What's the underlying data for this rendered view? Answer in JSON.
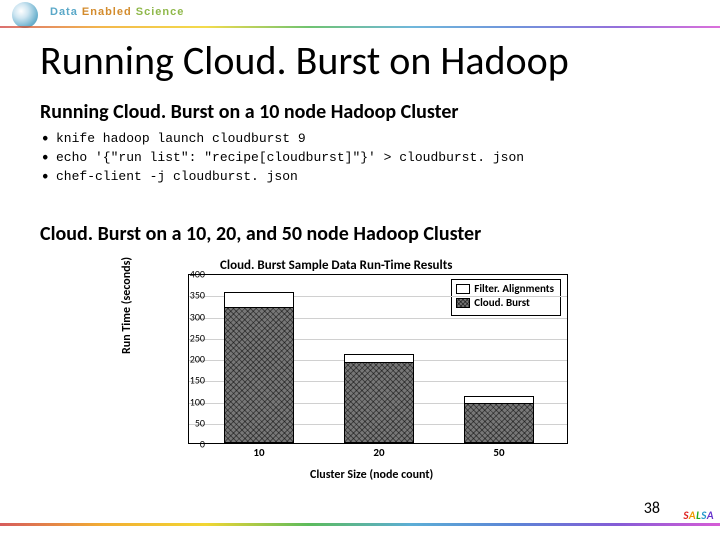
{
  "brand": {
    "w1": "Data",
    "w2": "Enabled",
    "w3": "Science"
  },
  "title": "Running Cloud. Burst on Hadoop",
  "subtitle1": "Running Cloud. Burst on a 10 node Hadoop Cluster",
  "bullets": [
    "knife hadoop launch cloudburst 9",
    "echo '{\"run list\": \"recipe[cloudburst]\"}' > cloudburst. json",
    "chef-client -j cloudburst. json"
  ],
  "subtitle2": "Cloud. Burst on a 10, 20, and 50 node Hadoop Cluster",
  "page_number": "38",
  "salsa": [
    "S",
    "A",
    "L",
    "S",
    "A"
  ],
  "chart_data": {
    "type": "bar",
    "title": "Cloud. Burst Sample Data Run-Time Results",
    "xlabel": "Cluster Size (node count)",
    "ylabel": "Run Time (seconds)",
    "ylim": [
      0,
      400
    ],
    "yticks": [
      0,
      50,
      100,
      150,
      200,
      250,
      300,
      350,
      400
    ],
    "categories": [
      "10",
      "20",
      "50"
    ],
    "series": [
      {
        "name": "Filter. Alignments",
        "values": [
          355,
          210,
          110
        ]
      },
      {
        "name": "Cloud. Burst",
        "values": [
          320,
          190,
          95
        ]
      }
    ],
    "legend_position": "top-right",
    "grid": true
  }
}
